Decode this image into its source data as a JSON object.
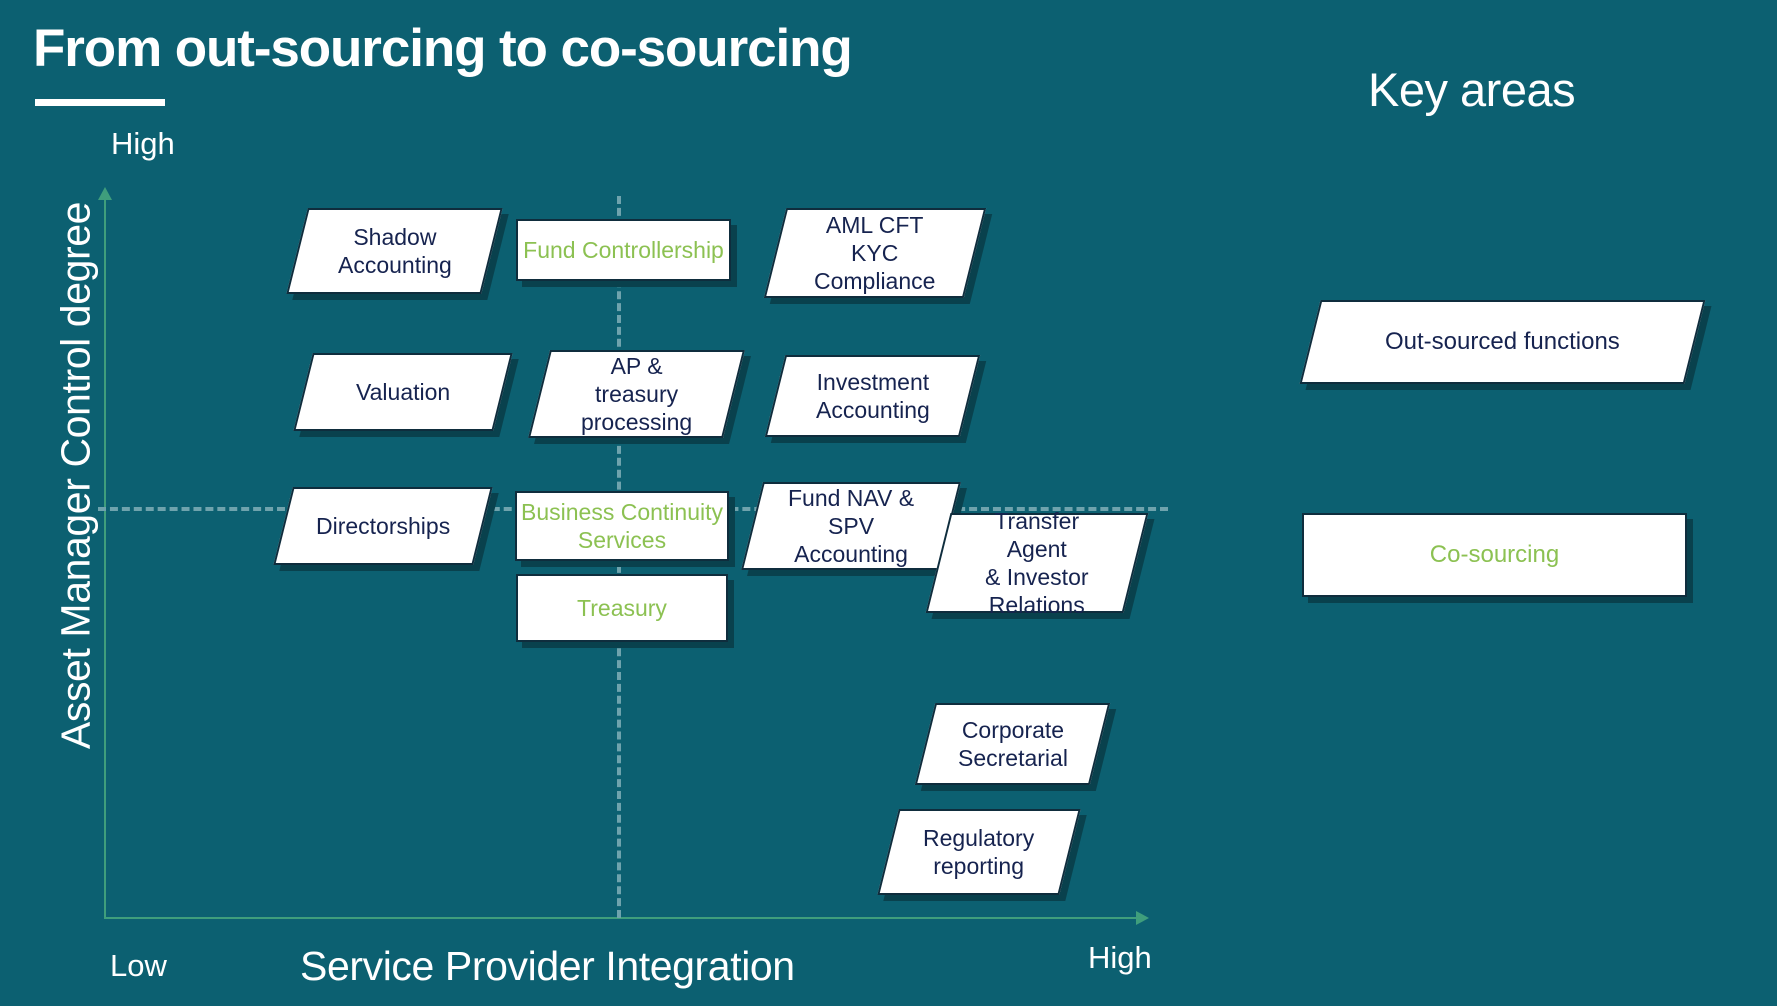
{
  "slide": {
    "title": "From out-sourcing to co-sourcing",
    "background_color": "#0c6071",
    "accent_green": "#8cc152",
    "navy_text": "#16234f",
    "axis_green": "#3f9e7c"
  },
  "key_areas": {
    "heading": "Key areas",
    "items": [
      {
        "label": "Out-sourced functions",
        "style": "out-sourced",
        "shape": "parallelogram",
        "text_color": "#16234f"
      },
      {
        "label": "Co-sourcing",
        "style": "co-sourcing",
        "shape": "rectangle",
        "text_color": "#8cc152"
      }
    ]
  },
  "chart_data": {
    "type": "scatter",
    "title": "From out-sourcing to co-sourcing",
    "xlabel": "Service Provider Integration",
    "ylabel": "Asset Manager Control degree",
    "x_ticks": [
      "Low",
      "High"
    ],
    "y_ticks": [
      "High"
    ],
    "grid": "dashed quadrant dividers at mid-x and mid-y",
    "legend": [
      "Out-sourced functions",
      "Co-sourcing"
    ],
    "legend_position": "right panel titled Key areas",
    "categories": [
      "out-sourced",
      "co-sourcing"
    ],
    "points": [
      {
        "label": "Shadow Accounting",
        "lines": [
          "Shadow",
          "Accounting"
        ],
        "category": "out-sourced",
        "x": 0.27,
        "y": 0.92
      },
      {
        "label": "Fund Controllership",
        "lines": [
          "Fund Controllership"
        ],
        "category": "co-sourcing",
        "x": 0.5,
        "y": 0.92
      },
      {
        "label": "AML CFT KYC Compliance",
        "lines": [
          "AML CFT",
          "KYC",
          "Compliance"
        ],
        "category": "out-sourced",
        "x": 0.72,
        "y": 0.92
      },
      {
        "label": "Valuation",
        "lines": [
          "Valuation"
        ],
        "category": "out-sourced",
        "x": 0.27,
        "y": 0.75
      },
      {
        "label": "AP & treasury processing",
        "lines": [
          "AP &",
          "treasury",
          "processing"
        ],
        "category": "out-sourced",
        "x": 0.5,
        "y": 0.75
      },
      {
        "label": "Investment Accounting",
        "lines": [
          "Investment",
          "Accounting"
        ],
        "category": "out-sourced",
        "x": 0.72,
        "y": 0.75
      },
      {
        "label": "Directorships",
        "lines": [
          "Directorships"
        ],
        "category": "out-sourced",
        "x": 0.26,
        "y": 0.57
      },
      {
        "label": "Business Continuity Services",
        "lines": [
          "Business Continuity",
          "Services"
        ],
        "category": "co-sourcing",
        "x": 0.49,
        "y": 0.57
      },
      {
        "label": "Fund NAV & SPV Accounting",
        "lines": [
          "Fund NAV &",
          "SPV",
          "Accounting"
        ],
        "category": "out-sourced",
        "x": 0.7,
        "y": 0.57
      },
      {
        "label": "Transfer Agent & Investor Relations",
        "lines": [
          "Transfer",
          "Agent",
          "& Investor",
          "Relations"
        ],
        "category": "out-sourced",
        "x": 0.85,
        "y": 0.52
      },
      {
        "label": "Treasury",
        "lines": [
          "Treasury"
        ],
        "category": "co-sourcing",
        "x": 0.49,
        "y": 0.45
      },
      {
        "label": "Corporate Secretarial",
        "lines": [
          "Corporate",
          "Secretarial"
        ],
        "category": "out-sourced",
        "x": 0.8,
        "y": 0.24
      },
      {
        "label": "Regulatory reporting",
        "lines": [
          "Regulatory",
          "reporting"
        ],
        "category": "out-sourced",
        "x": 0.78,
        "y": 0.13
      }
    ]
  }
}
